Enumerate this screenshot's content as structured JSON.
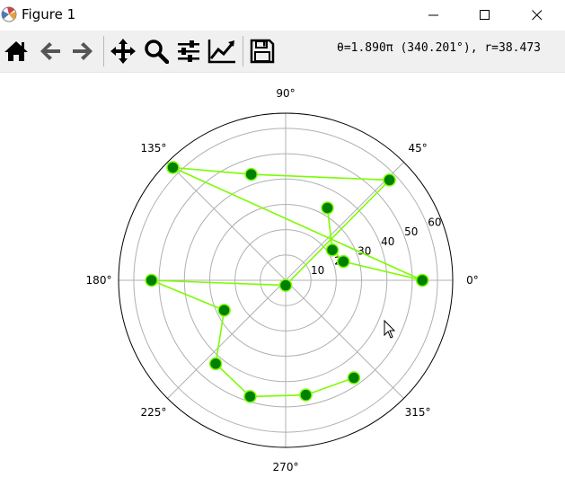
{
  "window": {
    "title": "Figure 1",
    "minimize_label": "minimize",
    "maximize_label": "maximize",
    "close_label": "close"
  },
  "toolbar": {
    "items": [
      {
        "name": "home-icon",
        "label": "Home"
      },
      {
        "name": "back-icon",
        "label": "Back"
      },
      {
        "name": "forward-icon",
        "label": "Forward"
      },
      {
        "name": "pan-icon",
        "label": "Pan"
      },
      {
        "name": "zoom-icon",
        "label": "Zoom"
      },
      {
        "name": "configure-subplots-icon",
        "label": "Configure subplots"
      },
      {
        "name": "edit-axis-icon",
        "label": "Edit axis"
      },
      {
        "name": "save-icon",
        "label": "Save"
      }
    ],
    "coordinates": "θ=1.890π (340.201°), r=38.473"
  },
  "colors": {
    "line": "#7cfc00",
    "marker_face": "#008000",
    "marker_edge": "#7cfc00",
    "grid": "#b0b0b0",
    "toolbar_bg": "#f0f0f0"
  },
  "chart_data": {
    "type": "line",
    "projection": "polar",
    "theta_unit": "degrees",
    "theta_ticks": [
      "0°",
      "45°",
      "90°",
      "135°",
      "180°",
      "225°",
      "270°",
      "315°"
    ],
    "r_ticks": [
      "10",
      "20",
      "30",
      "40",
      "50",
      "60"
    ],
    "rlim": [
      0,
      66
    ],
    "grid": true,
    "markers": "circle",
    "series": [
      {
        "theta": [
          60,
          33,
          18,
          0,
          135,
          108,
          44,
          270,
          180,
          206,
          230,
          253,
          280,
          305
        ],
        "r": [
          33,
          22,
          24,
          54,
          63,
          44,
          57,
          2,
          53,
          27,
          43,
          48,
          46,
          47
        ]
      }
    ]
  }
}
